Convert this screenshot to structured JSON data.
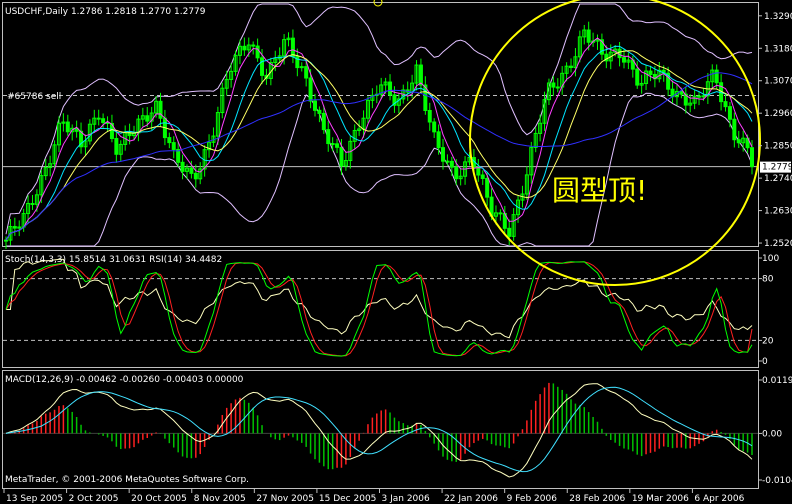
{
  "chart_data": [
    {
      "type": "candlestick",
      "panel": "price",
      "title": "USDCHF,Daily  1.2786 1.2818 1.2770 1.2779",
      "symbol": "USDCHF",
      "timeframe": "Daily",
      "ohlc_readout": {
        "open": 1.2786,
        "high": 1.2818,
        "low": 1.277,
        "close": 1.2779
      },
      "ylim": [
        1.251,
        1.333
      ],
      "yticks": [
        "1.3290",
        "1.3180",
        "1.3070",
        "1.2960",
        "1.2850",
        "1.2740",
        "1.2630",
        "1.2520"
      ],
      "current_price_label": "1.2779",
      "order_line": {
        "label": "#65786 sell",
        "price": 1.302
      },
      "annotation": "圆型顶!",
      "candle_count": 170,
      "close_path": [
        1.253,
        1.26,
        1.276,
        1.293,
        1.285,
        1.298,
        1.282,
        1.292,
        1.3,
        1.28,
        1.274,
        1.288,
        1.31,
        1.322,
        1.308,
        1.32,
        1.31,
        1.29,
        1.278,
        1.295,
        1.305,
        1.299,
        1.312,
        1.285,
        1.275,
        1.282,
        1.262,
        1.257,
        1.278,
        1.302,
        1.311,
        1.323,
        1.315,
        1.318,
        1.305,
        1.31,
        1.303,
        1.298,
        1.31,
        1.29,
        1.28
      ],
      "colors": {
        "candle": "#00ff00",
        "bollinger": "#e0c0ff",
        "ma_fast": "#ff40ff",
        "ma_mid": "#00e5ff",
        "ma_slow": "#ffff66",
        "ma_long": "#3030ff",
        "annotation": "#ffff00"
      }
    },
    {
      "type": "line",
      "panel": "stochastic_rsi",
      "title": "Stoch(14,3,3) 15.8514 31.0631  RSI(14) 34.4482",
      "ylim": [
        0,
        100
      ],
      "yticks": [
        "100",
        "80",
        "20",
        "0"
      ],
      "levels": [
        80,
        20
      ],
      "series": [
        {
          "name": "Stoch(14,3,3)",
          "last": 15.8514,
          "color": "#00ff00"
        },
        {
          "name": "Signal",
          "last": 31.0631,
          "color": "#ff2020"
        },
        {
          "name": "RSI(14)",
          "last": 34.4482,
          "color": "#ffffc0"
        }
      ]
    },
    {
      "type": "bar",
      "panel": "macd",
      "title": "MACD(12,26,9) -0.00462 -0.00260 -0.00403 0.00000",
      "ylim": [
        -0.0104,
        0.01193
      ],
      "yticks": [
        "0.01193",
        "0.00",
        "-0.0104"
      ],
      "series": [
        {
          "name": "MACD histogram",
          "color_up": "#ff2020",
          "color_down": "#00c000"
        },
        {
          "name": "MACD line",
          "color": "#ffffc0"
        },
        {
          "name": "Signal line",
          "color": "#40e0ff"
        }
      ]
    }
  ],
  "x_axis": {
    "labels": [
      "13 Sep 2005",
      "2 Oct 2005",
      "20 Oct 2005",
      "8 Nov 2005",
      "27 Nov 2005",
      "15 Dec 2005",
      "3 Jan 2006",
      "22 Jan 2006",
      "9 Feb 2006",
      "28 Feb 2006",
      "19 Mar 2006",
      "6 Apr 2006"
    ]
  },
  "copyright": "MetaTrader, © 2001-2006 MetaQuotes Software Corp."
}
